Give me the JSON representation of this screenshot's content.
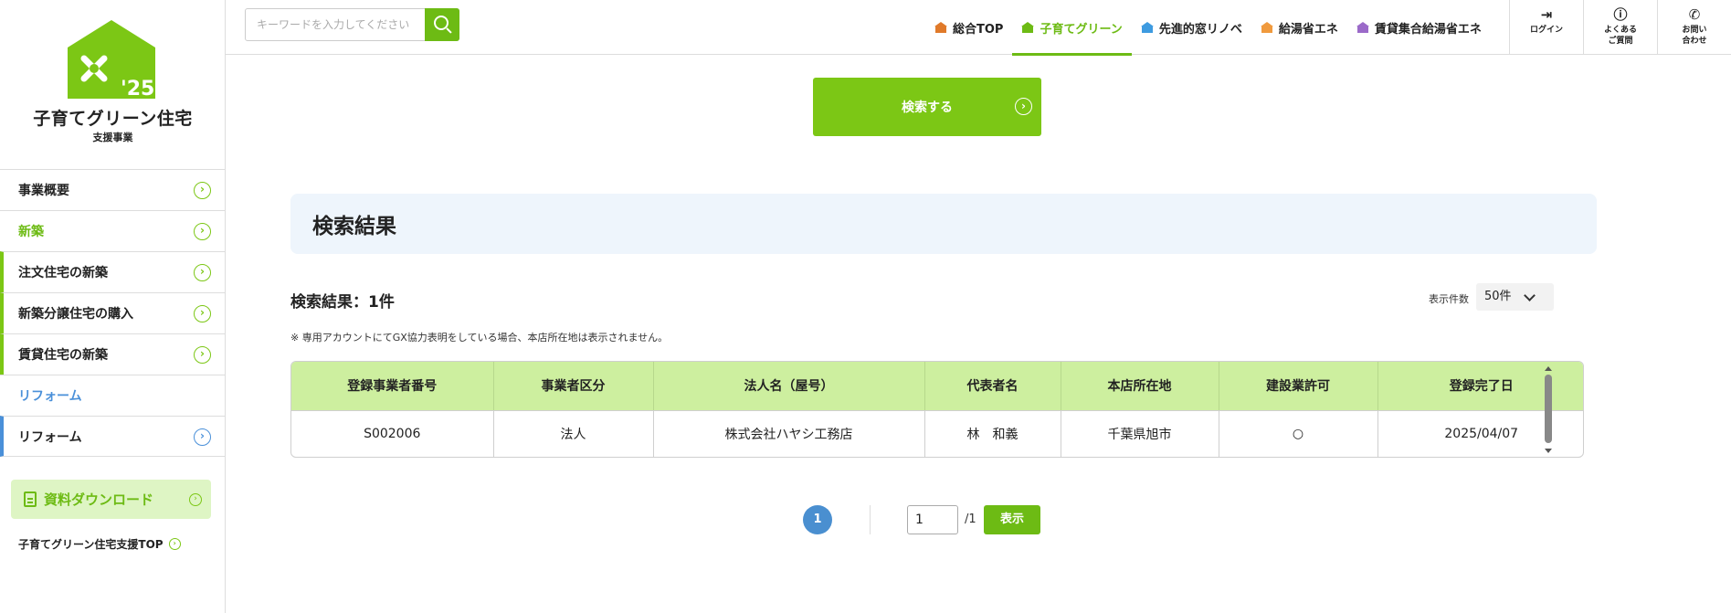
{
  "sidebar": {
    "logo": {
      "title": "子育てグリーン住宅",
      "sub": "支援事業",
      "year": "'25"
    },
    "nav": [
      {
        "label": "事業概要"
      },
      {
        "label": "新築"
      },
      {
        "label": "注文住宅の新築"
      },
      {
        "label": "新築分譲住宅の購入"
      },
      {
        "label": "賃貸住宅の新築"
      },
      {
        "label": "リフォーム"
      },
      {
        "label": "リフォーム"
      }
    ],
    "download_label": "資料ダウンロード",
    "top_link": "子育てグリーン住宅支援TOP"
  },
  "header": {
    "search_placeholder": "キーワードを入力してください",
    "tabs": [
      {
        "label": "総合TOP",
        "color": "#e07a2a"
      },
      {
        "label": "子育てグリーン",
        "color": "#6dbb14"
      },
      {
        "label": "先進的窓リノベ",
        "color": "#3e9be0"
      },
      {
        "label": "給湯省エネ",
        "color": "#f09a3e"
      },
      {
        "label": "賃貸集合給湯省エネ",
        "color": "#9b6ac9"
      }
    ],
    "login": "ログイン",
    "faq_line1": "よくある",
    "faq_line2": "ご質問",
    "contact_line1": "お問い",
    "contact_line2": "合わせ"
  },
  "main": {
    "search_button": "検索する",
    "results_title": "検索結果",
    "results_count": "検索結果：1件",
    "per_page_label": "表示件数",
    "per_page_value": "50件",
    "note": "※ 専用アカウントにてGX協力表明をしている場合、本店所在地は表示されません。",
    "table": {
      "headers": [
        "登録事業者番号",
        "事業者区分",
        "法人名（屋号）",
        "代表者名",
        "本店所在地",
        "建設業許可",
        "登録完了日"
      ],
      "rows": [
        [
          "S002006",
          "法人",
          "株式会社ハヤシ工務店",
          "林　和義",
          "千葉県旭市",
          "○",
          "2025/04/07"
        ]
      ]
    },
    "pager": {
      "current": "1",
      "input_value": "1",
      "total": "/1",
      "show_button": "表示"
    }
  },
  "colors": {
    "accent": "#7cc715",
    "accent_dark": "#6dbb14",
    "blue": "#4a8fd0",
    "header_bg": "#cdef9f"
  }
}
